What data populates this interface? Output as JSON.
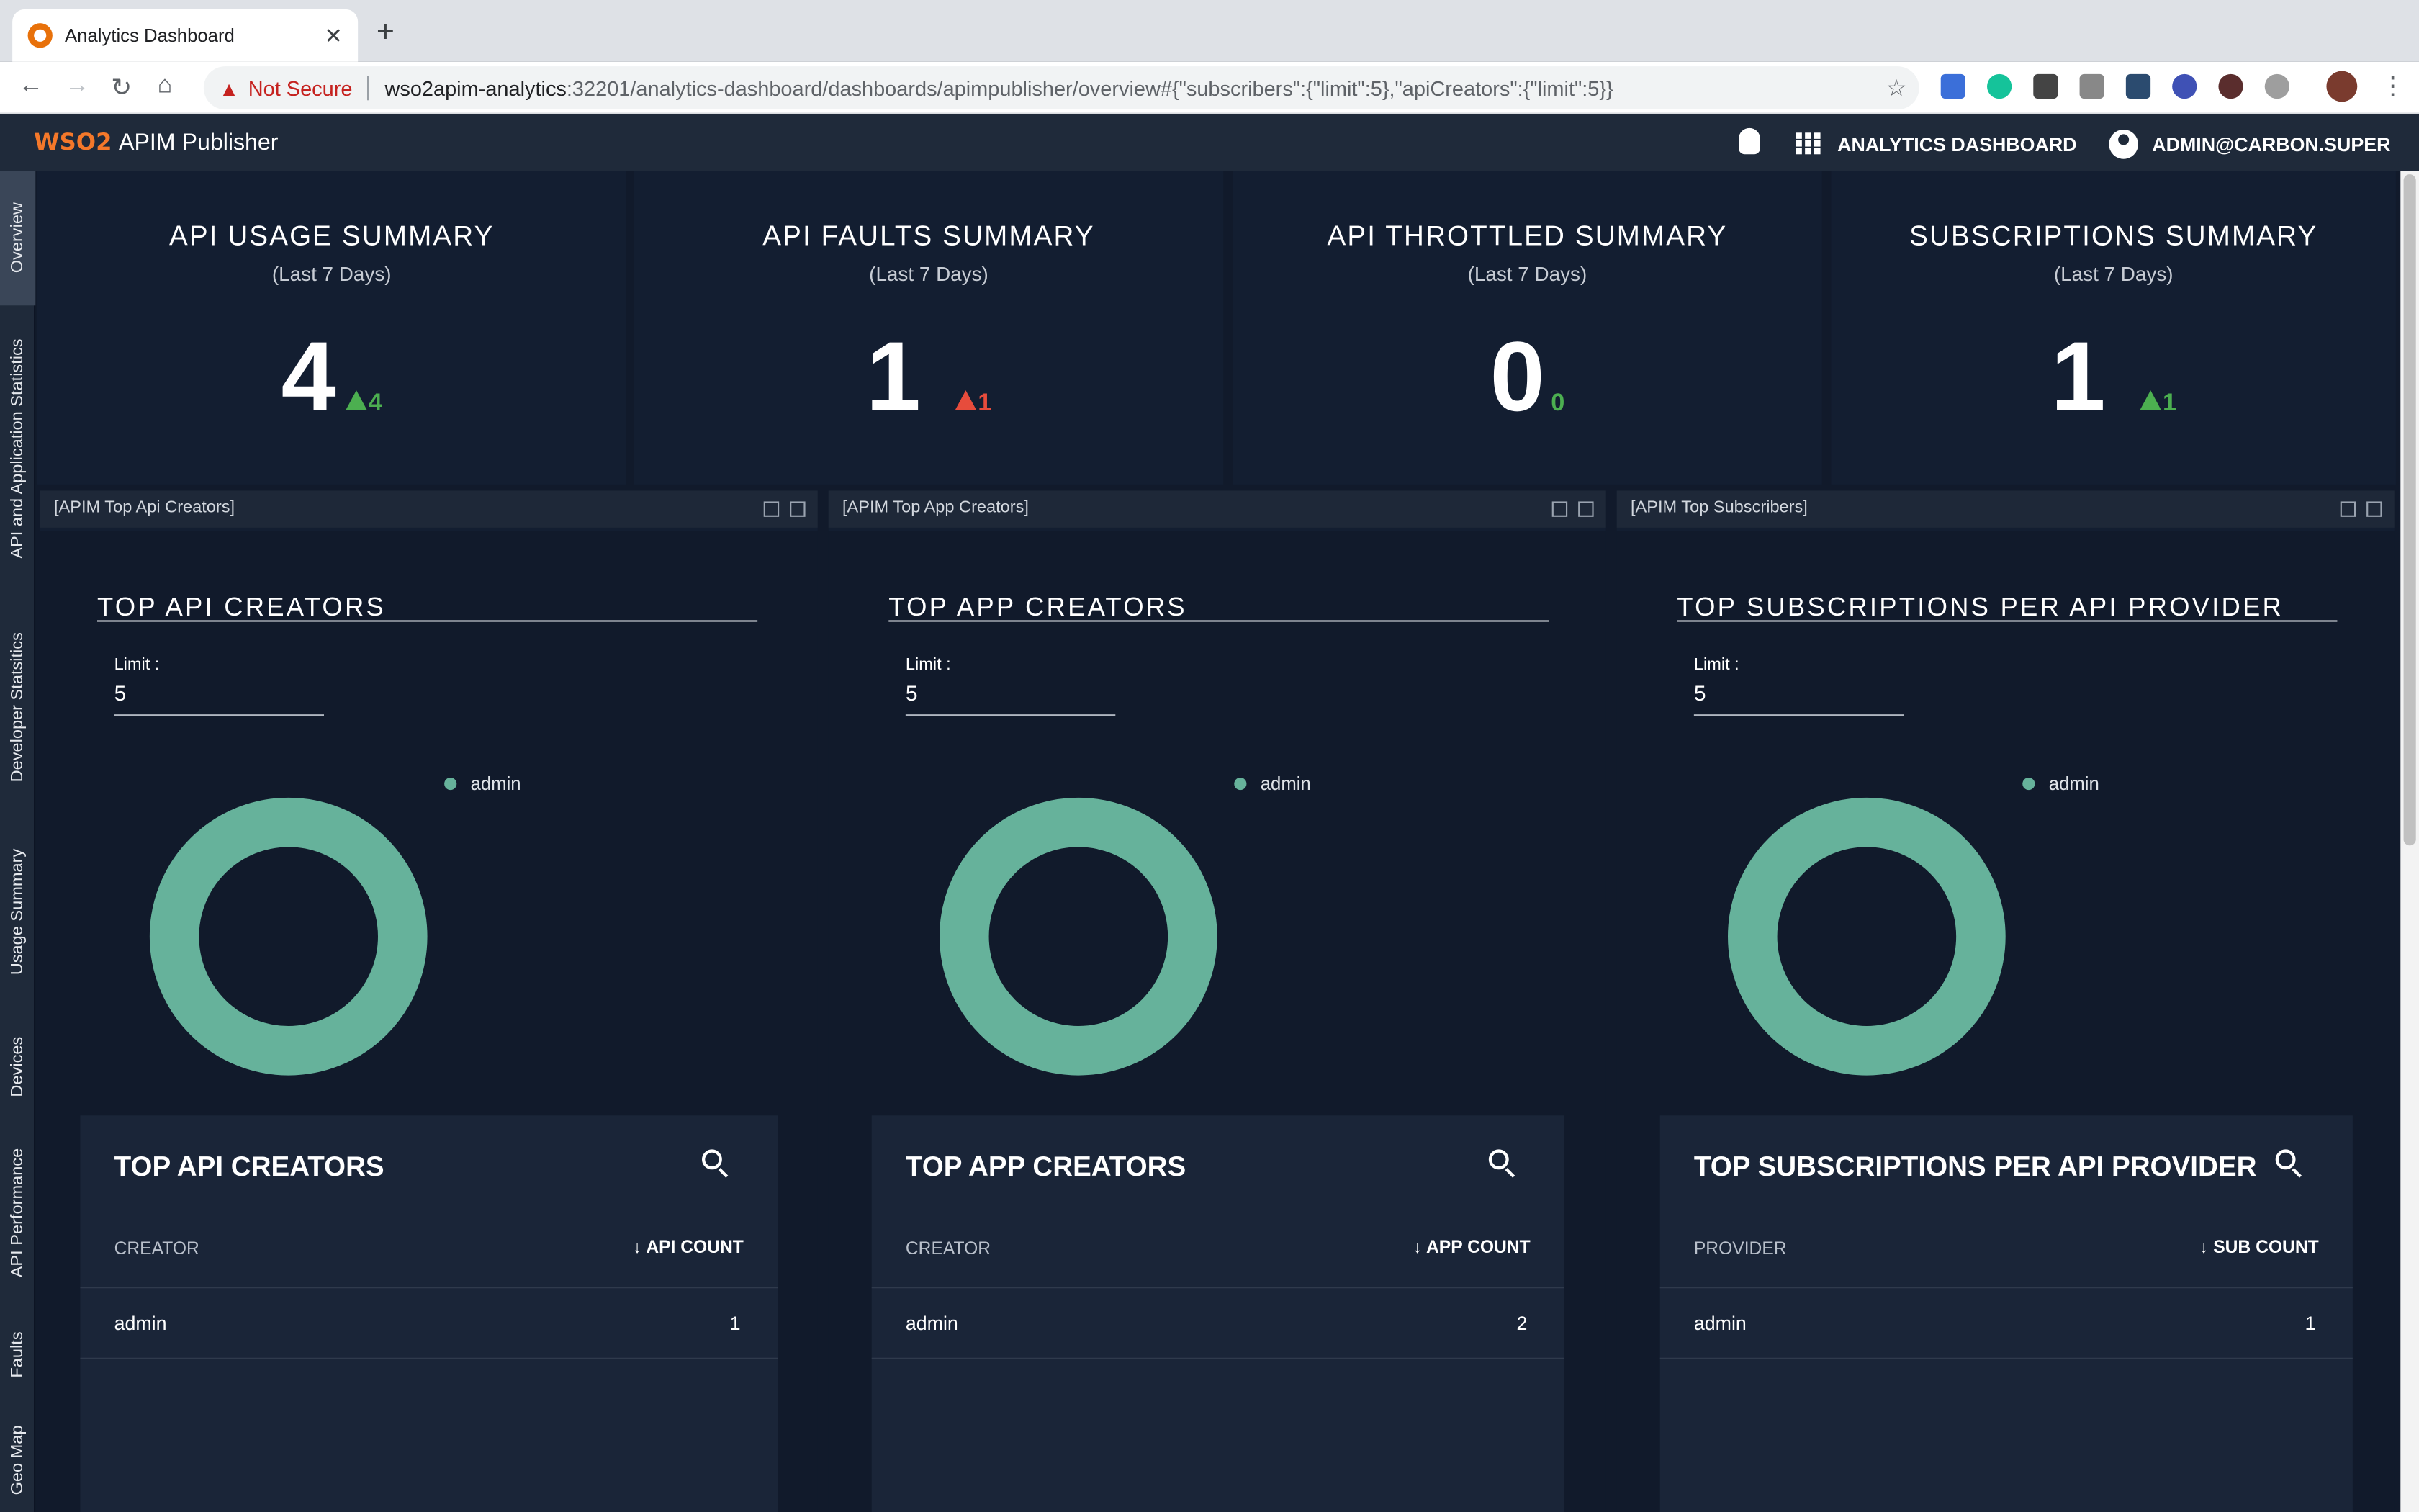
{
  "browser": {
    "tab_title": "Analytics Dashboard",
    "tab_close": "✕",
    "new_tab": "+",
    "security_label": "Not Secure",
    "url_host": "wso2apim-analytics",
    "url_rest": ":32201/analytics-dashboard/dashboards/apimpublisher/overview#{\"subscribers\":{\"limit\":5},\"apiCreators\":{\"limit\":5}}"
  },
  "appbar": {
    "logo": "WSO2",
    "title": "APIM Publisher",
    "dashboard_label": "ANALYTICS DASHBOARD",
    "user_label": "ADMIN@CARBON.SUPER"
  },
  "sidenav": [
    "Overview",
    "API and Application Statistics",
    "Developer Statsitics",
    "Usage Summary",
    "Devices",
    "API Performance",
    "Faults",
    "Geo Map"
  ],
  "kpis": [
    {
      "title": "API USAGE SUMMARY",
      "subtitle": "(Last 7 Days)",
      "value": "4",
      "delta": "4",
      "trend": "up",
      "color": "#4caf50"
    },
    {
      "title": "API FAULTS SUMMARY",
      "subtitle": "(Last 7 Days)",
      "value": "1",
      "delta": "1",
      "trend": "up",
      "color": "#e74c3c"
    },
    {
      "title": "API THROTTLED SUMMARY",
      "subtitle": "(Last 7 Days)",
      "value": "0",
      "delta": "0",
      "trend": "none",
      "color": "#4caf50"
    },
    {
      "title": "SUBSCRIPTIONS SUMMARY",
      "subtitle": "(Last 7 Days)",
      "value": "1",
      "delta": "1",
      "trend": "up",
      "color": "#4caf50"
    }
  ],
  "panels": [
    {
      "header": "[APIM Top Api Creators]",
      "chart_title": "TOP API CREATORS",
      "limit_label": "Limit :",
      "limit_value": "5",
      "legend": "admin",
      "table_title": "TOP API CREATORS",
      "col_left": "CREATOR",
      "col_right": "API COUNT",
      "row_name": "admin",
      "row_value": "1"
    },
    {
      "header": "[APIM Top App Creators]",
      "chart_title": "TOP APP CREATORS",
      "limit_label": "Limit :",
      "limit_value": "5",
      "legend": "admin",
      "table_title": "TOP APP CREATORS",
      "col_left": "CREATOR",
      "col_right": "APP COUNT",
      "row_name": "admin",
      "row_value": "2"
    },
    {
      "header": "[APIM Top Subscribers]",
      "chart_title": "TOP SUBSCRIPTIONS PER API PROVIDER",
      "limit_label": "Limit :",
      "limit_value": "5",
      "legend": "admin",
      "table_title": "TOP SUBSCRIPTIONS PER API PROVIDER",
      "col_left": "PROVIDER",
      "col_right": "SUB COUNT",
      "row_name": "admin",
      "row_value": "1"
    }
  ],
  "colors": {
    "donut": "#66b29b",
    "accent": "#f4782a"
  }
}
